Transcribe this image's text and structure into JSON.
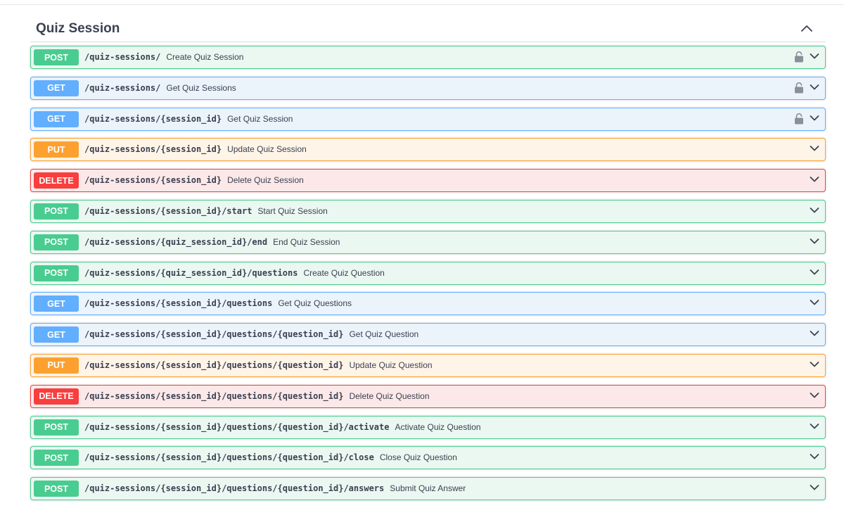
{
  "tag": {
    "title": "Quiz Session",
    "collapse_icon": "chevron-up-icon"
  },
  "operations": [
    {
      "method": "POST",
      "path": "/quiz-sessions/",
      "summary": "Create Quiz Session",
      "locked": true
    },
    {
      "method": "GET",
      "path": "/quiz-sessions/",
      "summary": "Get Quiz Sessions",
      "locked": true
    },
    {
      "method": "GET",
      "path": "/quiz-sessions/{session_id}",
      "summary": "Get Quiz Session",
      "locked": true
    },
    {
      "method": "PUT",
      "path": "/quiz-sessions/{session_id}",
      "summary": "Update Quiz Session",
      "locked": false
    },
    {
      "method": "DELETE",
      "path": "/quiz-sessions/{session_id}",
      "summary": "Delete Quiz Session",
      "locked": false
    },
    {
      "method": "POST",
      "path": "/quiz-sessions/{session_id}/start",
      "summary": "Start Quiz Session",
      "locked": false
    },
    {
      "method": "POST",
      "path": "/quiz-sessions/{quiz_session_id}/end",
      "summary": "End Quiz Session",
      "locked": false
    },
    {
      "method": "POST",
      "path": "/quiz-sessions/{quiz_session_id}/questions",
      "summary": "Create Quiz Question",
      "locked": false
    },
    {
      "method": "GET",
      "path": "/quiz-sessions/{session_id}/questions",
      "summary": "Get Quiz Questions",
      "locked": false
    },
    {
      "method": "GET",
      "path": "/quiz-sessions/{session_id}/questions/{question_id}",
      "summary": "Get Quiz Question",
      "locked": false
    },
    {
      "method": "PUT",
      "path": "/quiz-sessions/{session_id}/questions/{question_id}",
      "summary": "Update Quiz Question",
      "locked": false
    },
    {
      "method": "DELETE",
      "path": "/quiz-sessions/{session_id}/questions/{question_id}",
      "summary": "Delete Quiz Question",
      "locked": false
    },
    {
      "method": "POST",
      "path": "/quiz-sessions/{session_id}/questions/{question_id}/activate",
      "summary": "Activate Quiz Question",
      "locked": false
    },
    {
      "method": "POST",
      "path": "/quiz-sessions/{session_id}/questions/{question_id}/close",
      "summary": "Close Quiz Question",
      "locked": false
    },
    {
      "method": "POST",
      "path": "/quiz-sessions/{session_id}/questions/{question_id}/answers",
      "summary": "Submit Quiz Answer",
      "locked": false
    }
  ],
  "colors": {
    "POST": "#49cc90",
    "GET": "#61affe",
    "PUT": "#fca130",
    "DELETE": "#f93e3e",
    "text": "#3b4151"
  },
  "icons": {
    "lock": "lock-icon",
    "expand": "chevron-down-icon"
  }
}
